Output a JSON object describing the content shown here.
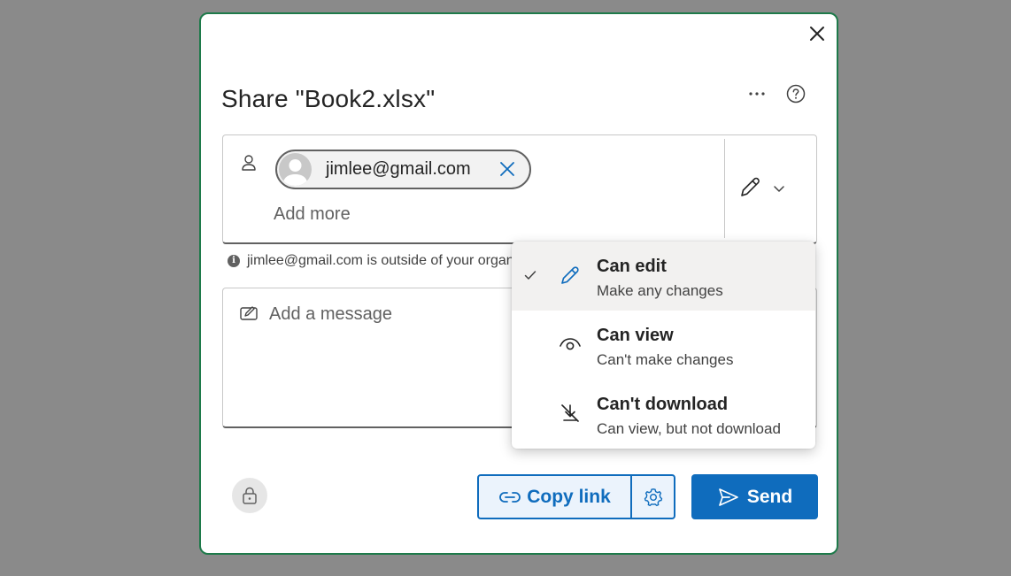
{
  "dialog": {
    "title": "Share \"Book2.xlsx\"",
    "colors": {
      "accent": "#0f6cbd",
      "border": "#1e7a4a"
    }
  },
  "recipients": {
    "chips": [
      {
        "email": "jimlee@gmail.com"
      }
    ],
    "add_more_placeholder": "Add more"
  },
  "warning": {
    "text": "jimlee@gmail.com is outside of your organization."
  },
  "message": {
    "placeholder": "Add a message"
  },
  "actions": {
    "copy_link_label": "Copy link",
    "send_label": "Send"
  },
  "permission_menu": {
    "items": [
      {
        "title": "Can edit",
        "description": "Make any changes",
        "icon": "pencil-icon",
        "selected": true
      },
      {
        "title": "Can view",
        "description": "Can't make changes",
        "icon": "eye-icon",
        "selected": false
      },
      {
        "title": "Can't download",
        "description": "Can view, but not download",
        "icon": "no-download-icon",
        "selected": false
      }
    ]
  }
}
